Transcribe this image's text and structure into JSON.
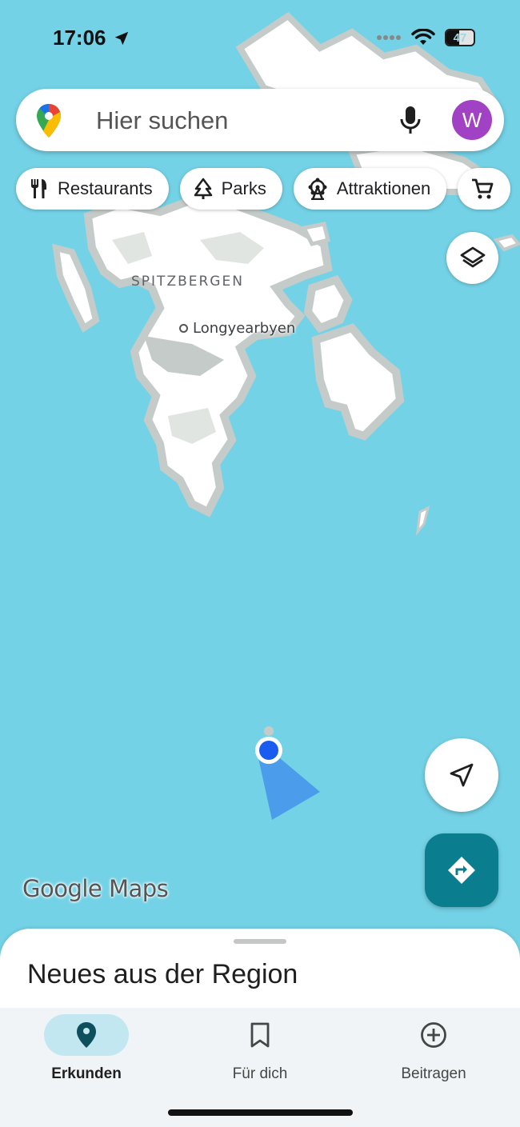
{
  "status_bar": {
    "time": "17:06",
    "battery_level": "47",
    "battery_fraction": 0.47
  },
  "map": {
    "region_label": "SPITZBERGEN",
    "city_label": "Longyearbyen",
    "water_color": "#74d2e6",
    "land_color": "#ffffff",
    "terrain_color": "#c5cbc8",
    "user_location_color": "#1a5cf0"
  },
  "search": {
    "placeholder": "Hier suchen",
    "avatar_initial": "W",
    "avatar_color": "#a142c4"
  },
  "chips": [
    {
      "label": "Restaurants",
      "icon": "fork-knife-icon"
    },
    {
      "label": "Parks",
      "icon": "tree-icon"
    },
    {
      "label": "Attraktionen",
      "icon": "ferris-wheel-icon"
    },
    {
      "label": "",
      "icon": "shopping-cart-icon"
    }
  ],
  "buttons": {
    "layers_icon": "layers-icon",
    "my_location_icon": "navigation-arrow-icon",
    "directions_icon": "directions-icon",
    "directions_color": "#0a7d8e"
  },
  "branding": {
    "logo_text": "Google Maps"
  },
  "sheet": {
    "title": "Neues aus der Region"
  },
  "bottom_nav": {
    "items": [
      {
        "label": "Erkunden",
        "icon": "location-pin-icon",
        "active": true
      },
      {
        "label": "Für dich",
        "icon": "bookmark-icon",
        "active": false
      },
      {
        "label": "Beitragen",
        "icon": "add-circle-icon",
        "active": false
      }
    ]
  }
}
